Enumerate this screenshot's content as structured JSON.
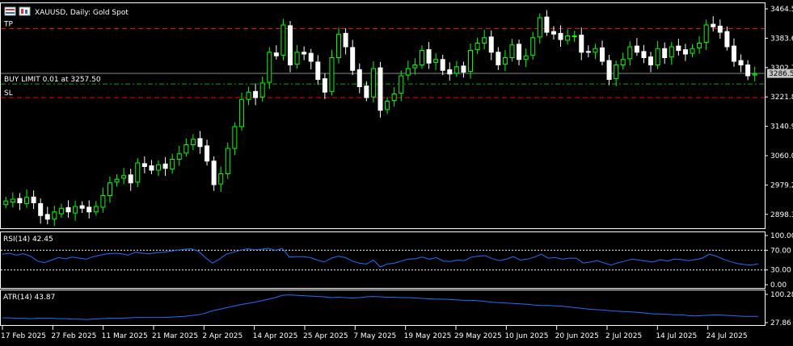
{
  "window": {
    "symbol_title": "XAUUSD, Daily:  Gold Spot"
  },
  "levels": {
    "tp_label": "TP",
    "order_label": "BUY LIMIT 0.01 at 3257.50",
    "sl_label": "SL",
    "current_price_label": "3286.53",
    "tp_price": 3410,
    "order_price": 3257.5,
    "sl_price": 3220,
    "current_price": 3286.53
  },
  "colors": {
    "up": "#00ff00",
    "down": "#ffffff",
    "level_line": "#ff0000",
    "order_line": "#00b000",
    "indicator_line": "#1e6fff",
    "grid_frame": "#ffffff"
  },
  "price_axis": {
    "ticks": [
      "3464.5",
      "3383.6",
      "3302.7",
      "3221.8",
      "3140.9",
      "3060.0",
      "2979.2",
      "2898.3"
    ],
    "range": [
      2860,
      3480
    ]
  },
  "rsi": {
    "title": "RSI(14) 42.45",
    "ticks": [
      "100.00",
      "70.00",
      "30.00",
      "0.00"
    ],
    "levels": [
      70,
      30
    ]
  },
  "atr": {
    "title": "ATR(14) 43.87",
    "ticks": [
      "100.28",
      "27.86"
    ]
  },
  "date_axis": {
    "labels": [
      "17 Feb 2025",
      "27 Feb 2025",
      "11 Mar 2025",
      "21 Mar 2025",
      "2 Apr 2025",
      "14 Apr 2025",
      "25 Apr 2025",
      "7 May 2025",
      "19 May 2025",
      "29 May 2025",
      "10 Jun 2025",
      "20 Jun 2025",
      "2 Jul 2025",
      "14 Jul 2025",
      "24 Jul 2025"
    ]
  },
  "chart_data": [
    {
      "type": "candlestick",
      "title": "XAUUSD, Daily:  Gold Spot",
      "x_range": [
        "17 Feb 2025",
        "29 Jul 2025"
      ],
      "ylim": [
        2860,
        3480
      ],
      "close": [
        2935,
        2940,
        2930,
        2945,
        2930,
        2895,
        2885,
        2905,
        2915,
        2905,
        2920,
        2915,
        2905,
        2920,
        2950,
        2985,
        2995,
        3005,
        2985,
        3040,
        3030,
        3020,
        3035,
        3025,
        3050,
        3065,
        3090,
        3105,
        3085,
        3045,
        2980,
        3010,
        3080,
        3140,
        3215,
        3235,
        3220,
        3260,
        3345,
        3335,
        3420,
        3310,
        3345,
        3340,
        3320,
        3270,
        3235,
        3330,
        3395,
        3360,
        3295,
        3250,
        3220,
        3300,
        3185,
        3210,
        3230,
        3280,
        3300,
        3310,
        3350,
        3315,
        3325,
        3295,
        3285,
        3305,
        3290,
        3350,
        3370,
        3385,
        3345,
        3310,
        3330,
        3365,
        3325,
        3335,
        3385,
        3440,
        3400,
        3395,
        3380,
        3390,
        3390,
        3345,
        3345,
        3355,
        3320,
        3270,
        3310,
        3325,
        3360,
        3345,
        3330,
        3310,
        3355,
        3330,
        3360,
        3350,
        3340,
        3355,
        3370,
        3420,
        3415,
        3400,
        3360,
        3320,
        3310,
        3280,
        3285
      ],
      "open": [
        2925,
        2932,
        2942,
        2928,
        2946,
        2928,
        2898,
        2885,
        2900,
        2917,
        2902,
        2922,
        2918,
        2905,
        2918,
        2950,
        2987,
        2998,
        3007,
        2987,
        3038,
        3032,
        3020,
        3037,
        3023,
        3050,
        3067,
        3090,
        3107,
        3087,
        3045,
        2982,
        3010,
        3080,
        3140,
        3215,
        3237,
        3222,
        3262,
        3343,
        3337,
        3418,
        3312,
        3345,
        3342,
        3318,
        3272,
        3237,
        3330,
        3397,
        3358,
        3297,
        3252,
        3222,
        3302,
        3187,
        3212,
        3232,
        3282,
        3302,
        3310,
        3352,
        3317,
        3325,
        3297,
        3287,
        3307,
        3292,
        3352,
        3370,
        3387,
        3345,
        3312,
        3330,
        3367,
        3325,
        3337,
        3387,
        3442,
        3402,
        3397,
        3378,
        3390,
        3392,
        3347,
        3345,
        3357,
        3322,
        3272,
        3310,
        3327,
        3362,
        3347,
        3332,
        3310,
        3355,
        3332,
        3362,
        3352,
        3342,
        3357,
        3372,
        3422,
        3417,
        3402,
        3362,
        3322,
        3310,
        3282
      ]
    },
    {
      "type": "line",
      "title": "RSI(14) 42.45",
      "ylim": [
        0,
        100
      ],
      "series": [
        {
          "name": "RSI(14)",
          "values": [
            62,
            64,
            60,
            63,
            58,
            48,
            45,
            50,
            55,
            53,
            56,
            54,
            52,
            57,
            60,
            63,
            64,
            63,
            60,
            66,
            64,
            63,
            65,
            66,
            68,
            70,
            72,
            73,
            68,
            55,
            44,
            52,
            62,
            66,
            70,
            73,
            71,
            72,
            74,
            70,
            74,
            56,
            57,
            57,
            55,
            50,
            46,
            54,
            58,
            55,
            48,
            44,
            42,
            50,
            36,
            42,
            44,
            48,
            52,
            53,
            56,
            52,
            55,
            48,
            47,
            50,
            49,
            56,
            58,
            59,
            53,
            49,
            52,
            57,
            50,
            52,
            56,
            62,
            54,
            55,
            52,
            54,
            54,
            44,
            46,
            49,
            44,
            40,
            45,
            48,
            52,
            50,
            48,
            46,
            51,
            48,
            52,
            51,
            49,
            51,
            54,
            62,
            58,
            52,
            47,
            43,
            41,
            40,
            42.45
          ]
        }
      ]
    },
    {
      "type": "line",
      "title": "ATR(14) 43.87",
      "ylim": [
        27.86,
        100.28
      ],
      "series": [
        {
          "name": "ATR(14)",
          "values": [
            40,
            40,
            39,
            39,
            38,
            39,
            39,
            39,
            38,
            38,
            37,
            37,
            36,
            37,
            38,
            39,
            39,
            39,
            40,
            41,
            41,
            41,
            41,
            41,
            42,
            43,
            44,
            46,
            48,
            52,
            58,
            62,
            66,
            70,
            74,
            77,
            80,
            84,
            88,
            92,
            98,
            99,
            98,
            97,
            96,
            95,
            94,
            92,
            93,
            92,
            91,
            92,
            94,
            95,
            94,
            93,
            93,
            92,
            92,
            91,
            90,
            89,
            88,
            88,
            87,
            86,
            85,
            85,
            84,
            82,
            80,
            79,
            78,
            77,
            76,
            75,
            73,
            72,
            72,
            71,
            70,
            68,
            66,
            64,
            62,
            61,
            60,
            58,
            57,
            56,
            55,
            54,
            52,
            50,
            50,
            49,
            48,
            48,
            46,
            45,
            46,
            47,
            48,
            47,
            46,
            45,
            44,
            44,
            43.87
          ]
        }
      ]
    }
  ]
}
